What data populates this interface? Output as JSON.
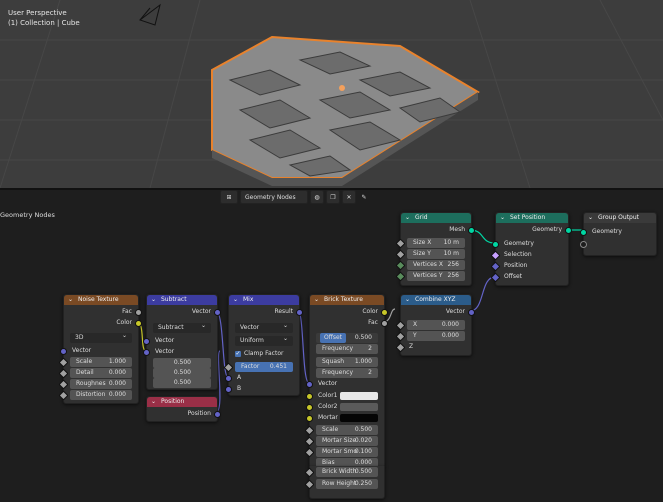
{
  "viewport": {
    "title": "User Perspective",
    "subtitle": "(1) Collection | Cube"
  },
  "header": {
    "tree_name": "Geometry Nodes",
    "editor_label": "Geometry Nodes"
  },
  "nodes": {
    "noise": {
      "title": "Noise Texture",
      "out_fac": "Fac",
      "out_color": "Color",
      "dim": "3D",
      "in_vector": "Vector",
      "fields": [
        {
          "label": "Scale",
          "value": "1.000"
        },
        {
          "label": "Detail",
          "value": "0.000"
        },
        {
          "label": "Roughnes",
          "value": "0.000"
        },
        {
          "label": "Distortion",
          "value": "0.000"
        }
      ]
    },
    "subtract": {
      "title": "Subtract",
      "out": "Vector",
      "op": "Subtract",
      "in_a": "Vector",
      "in_b": "Vector",
      "vals": [
        "0.500",
        "0.500",
        "0.500"
      ]
    },
    "position": {
      "title": "Position",
      "out": "Position"
    },
    "mix": {
      "title": "Mix",
      "out": "Result",
      "type": "Vector",
      "mode": "Uniform",
      "clamp": "Clamp Factor",
      "factor_label": "Factor",
      "factor_value": "0.451",
      "in_a": "A",
      "in_b": "B"
    },
    "brick": {
      "title": "Brick Texture",
      "out_color": "Color",
      "out_fac": "Fac",
      "offset": {
        "label": "Offset",
        "value": "0.500"
      },
      "frequency1": {
        "label": "Frequency",
        "value": "2"
      },
      "squash": {
        "label": "Squash",
        "value": "1.000"
      },
      "frequency2": {
        "label": "Frequency",
        "value": "2"
      },
      "in_vector": "Vector",
      "color1": "Color1",
      "color2": "Color2",
      "mortar": "Mortar",
      "fields": [
        {
          "label": "Scale",
          "value": "0.500"
        },
        {
          "label": "Mortar Size",
          "value": "0.020"
        },
        {
          "label": "Mortar Smo",
          "value": "0.100"
        },
        {
          "label": "Bias",
          "value": "0.000"
        },
        {
          "label": "Brick Width",
          "value": "0.500"
        },
        {
          "label": "Row Height",
          "value": "0.250"
        }
      ]
    },
    "grid": {
      "title": "Grid",
      "out": "Mesh",
      "fields": [
        {
          "label": "Size X",
          "value": "10 m"
        },
        {
          "label": "Size Y",
          "value": "10 m"
        },
        {
          "label": "Vertices X",
          "value": "256"
        },
        {
          "label": "Vertices Y",
          "value": "256"
        }
      ]
    },
    "combine": {
      "title": "Combine XYZ",
      "out": "Vector",
      "x": {
        "label": "X",
        "value": "0.000"
      },
      "y": {
        "label": "Y",
        "value": "0.000"
      },
      "z": "Z"
    },
    "setpos": {
      "title": "Set Position",
      "out": "Geometry",
      "in_geo": "Geometry",
      "in_sel": "Selection",
      "in_pos": "Position",
      "in_off": "Offset"
    },
    "output": {
      "title": "Group Output",
      "in_geo": "Geometry"
    }
  },
  "colors": {
    "accent": "#4772b3",
    "geometry_socket": "#00d6a3",
    "vector_socket": "#6363c7",
    "color_socket": "#c7c729",
    "selection_orange": "#e8822c"
  }
}
